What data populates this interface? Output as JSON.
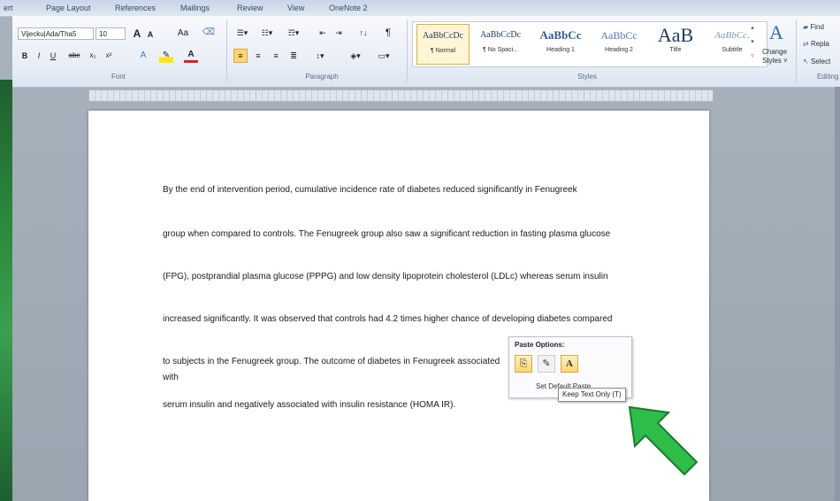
{
  "tabs": [
    "ert",
    "Page Layout",
    "References",
    "Mailings",
    "Review",
    "View",
    "OneNote 2"
  ],
  "font": {
    "name": "Vijecku|Ada/Tha5",
    "size": "10",
    "grow_icon": "A",
    "shrink_icon": "A",
    "case_label": "Aa",
    "bold": "B",
    "italic": "I",
    "underline": "U",
    "strike": "abc",
    "subscript": "x₂",
    "superscript": "x²",
    "text_color": "A"
  },
  "paragraph": {
    "pilcrow": "¶",
    "sort": "↑↓"
  },
  "groups": {
    "font": "Font",
    "paragraph": "Paragraph",
    "styles": "Styles",
    "editing": "Editing"
  },
  "styles": [
    {
      "sample": "AaBbCcDc",
      "label": "¶ Normal"
    },
    {
      "sample": "AaBbCcDc",
      "label": "¶ No Spaci..."
    },
    {
      "sample": "AaBbCc",
      "label": "Heading 1"
    },
    {
      "sample": "AaBbCc",
      "label": "Heading 2"
    },
    {
      "sample": "AaB",
      "label": "Title"
    },
    {
      "sample": "AaBbCc.",
      "label": "Subtitle"
    }
  ],
  "change_styles": {
    "icon": "A",
    "label_1": "Change",
    "label_2": "Styles ˅"
  },
  "editing": {
    "find": "Find",
    "replace": "Repla",
    "select": "Select"
  },
  "document": {
    "paragraphs": [
      "By the end of intervention period, cumulative incidence rate of diabetes reduced significantly in Fenugreek",
      "group when compared to controls. The Fenugreek group also saw a significant reduction in fasting plasma glucose",
      "(FPG), postprandial plasma glucose (PPPG) and low density lipoprotein cholesterol (LDLc) whereas serum insulin",
      "increased significantly. It was observed that controls had 4.2 times higher chance of developing diabetes compared",
      "to subjects in the Fenugreek group. The outcome of diabetes in Fenugreek associated with",
      "serum insulin and negatively associated with insulin resistance (HOMA IR)."
    ]
  },
  "paste_options": {
    "title": "Paste Options:",
    "options": [
      "⎘",
      "✎",
      "A"
    ],
    "set_default": "Set Default Paste...",
    "tooltip": "Keep Text Only (T)"
  },
  "colors": {
    "arrow_fill": "#2fbd4a",
    "arrow_stroke": "#1a7a2a",
    "highlight": "#ffd66e",
    "text_color_bar": "#e02020"
  }
}
